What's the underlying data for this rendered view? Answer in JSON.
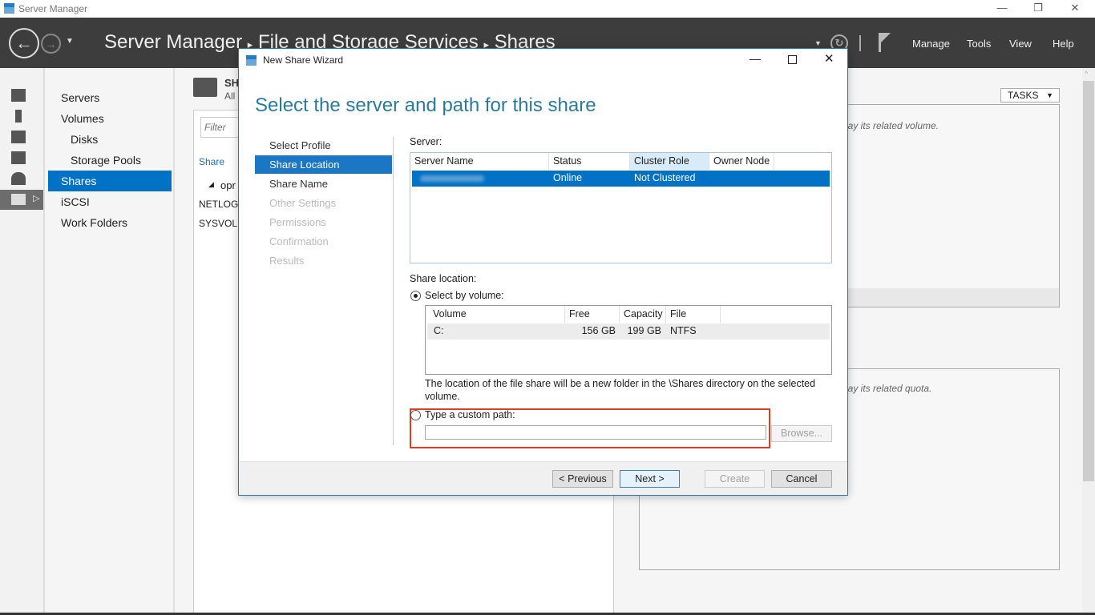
{
  "window": {
    "title": "Server Manager",
    "minimize": "—",
    "restore": "❐",
    "close": "✕"
  },
  "header": {
    "breadcrumb": [
      "Server Manager",
      "File and Storage Services",
      "Shares"
    ],
    "separator": "▸",
    "menu": [
      "Manage",
      "Tools",
      "View",
      "Help"
    ]
  },
  "nav": {
    "items": [
      {
        "label": "Servers"
      },
      {
        "label": "Volumes"
      },
      {
        "label": "Disks"
      },
      {
        "label": "Storage Pools"
      },
      {
        "label": "Shares"
      },
      {
        "label": "iSCSI"
      },
      {
        "label": "Work Folders"
      }
    ],
    "selected": "Shares"
  },
  "shares_panel": {
    "title": "SH",
    "subtitle": "All",
    "filter_placeholder": "Filter",
    "column": "Share",
    "group": "opr",
    "rows": [
      "NETLOGO",
      "SYSVOL"
    ]
  },
  "right_panel": {
    "tasks": "TASKS",
    "volume_hint": "lay its related volume.",
    "quota_hint": "lay its related quota."
  },
  "dialog": {
    "title": "New Share Wizard",
    "heading": "Select the server and path for this share",
    "steps": [
      {
        "label": "Select Profile",
        "state": "done"
      },
      {
        "label": "Share Location",
        "state": "current"
      },
      {
        "label": "Share Name",
        "state": "enabled"
      },
      {
        "label": "Other Settings",
        "state": "disabled"
      },
      {
        "label": "Permissions",
        "state": "disabled"
      },
      {
        "label": "Confirmation",
        "state": "disabled"
      },
      {
        "label": "Results",
        "state": "disabled"
      }
    ],
    "server_label": "Server:",
    "server_columns": [
      "Server Name",
      "Status",
      "Cluster Role",
      "Owner Node"
    ],
    "server_rows": [
      {
        "status": "Online",
        "cluster_role": "Not Clustered",
        "owner_node": ""
      }
    ],
    "share_location_label": "Share location:",
    "select_by_volume": "Select by volume:",
    "volume_columns": [
      "Volume",
      "Free Space",
      "Capacity",
      "File System"
    ],
    "volume_rows": [
      {
        "volume": "C:",
        "free": "156 GB",
        "capacity": "199 GB",
        "fs": "NTFS"
      }
    ],
    "description": "The location of the file share will be a new folder in the \\Shares directory on the selected volume.",
    "custom_path_label": "Type a custom path:",
    "custom_path_value": "",
    "browse": "Browse...",
    "buttons": {
      "previous": "< Previous",
      "next": "Next >",
      "create": "Create",
      "cancel": "Cancel"
    },
    "highlight_color": "#e03c1f"
  }
}
